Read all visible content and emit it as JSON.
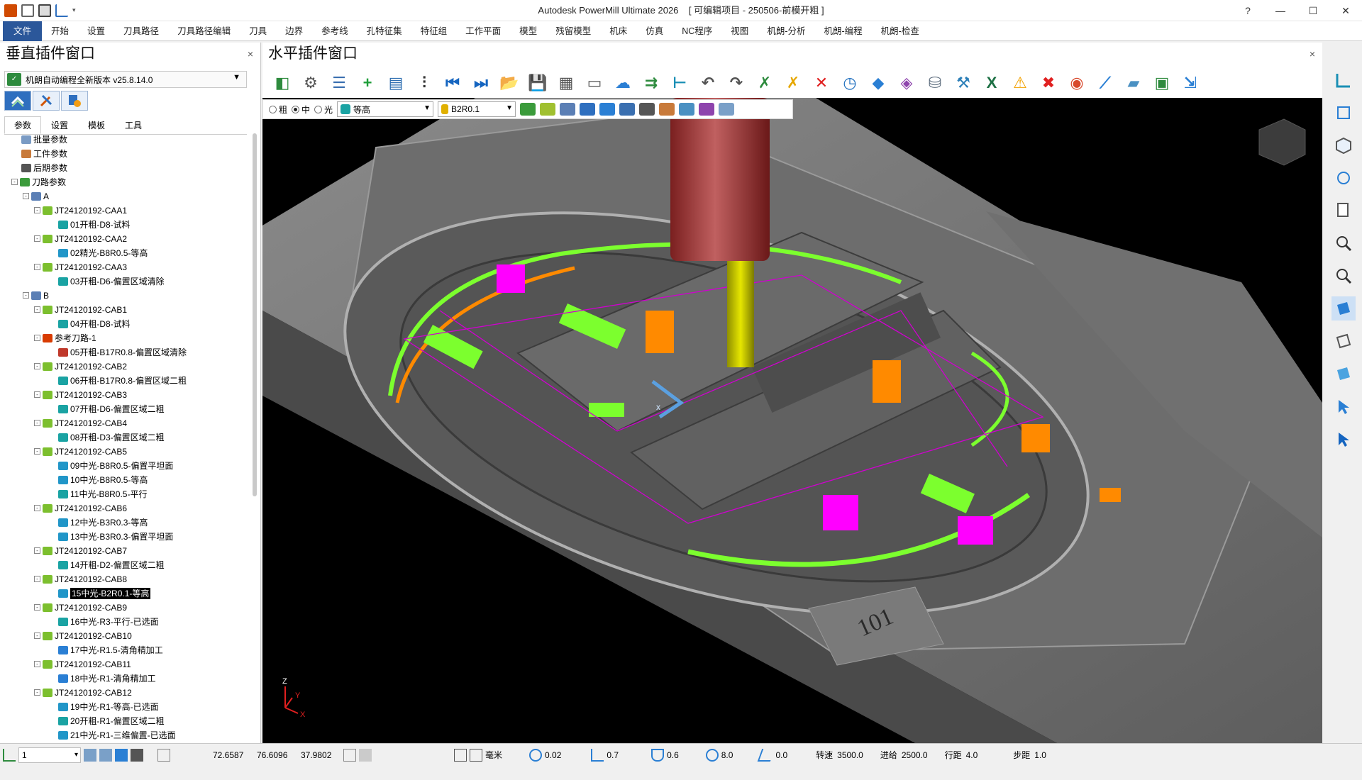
{
  "app": {
    "title": "Autodesk PowerMill Ultimate 2026",
    "project": "[ 可编辑项目 - 250506-前模开粗 ]"
  },
  "window_controls": {
    "help": "?",
    "minimize": "—",
    "maximize": "☐",
    "close": "✕"
  },
  "menu": [
    "文件",
    "开始",
    "设置",
    "刀具路径",
    "刀具路径编辑",
    "刀具",
    "边界",
    "参考线",
    "孔特征集",
    "特征组",
    "工作平面",
    "模型",
    "残留模型",
    "机床",
    "仿真",
    "NC程序",
    "视图",
    "机朗-分析",
    "机朗-编程",
    "机朗-检查"
  ],
  "left_panel": {
    "title": "垂直插件窗口",
    "close": "×",
    "plugin_name": "机朗自动编程全新版本 v25.8.14.0",
    "plugin_logo": "excel-like-logo",
    "subtabs": [
      "参数",
      "设置",
      "模板",
      "工具"
    ],
    "tree": [
      {
        "level": 1,
        "label": "批量参数",
        "icon": "params-icon",
        "color": "#7a9bc4",
        "exp": ""
      },
      {
        "level": 1,
        "label": "工件参数",
        "icon": "stock-icon",
        "color": "#c87a3a",
        "exp": ""
      },
      {
        "level": 1,
        "label": "后期参数",
        "icon": "post-icon",
        "color": "#555555",
        "exp": ""
      },
      {
        "level": 1,
        "label": "刀路参数",
        "icon": "toolpath-params-icon",
        "color": "#3b9b3b",
        "exp": "-"
      },
      {
        "level": 2,
        "label": "A",
        "icon": "folder-icon",
        "color": "#5b7fb5",
        "exp": "-"
      },
      {
        "level": 3,
        "label": "JT24120192-CAA1",
        "icon": "group-icon",
        "color": "#7cbf2e",
        "exp": "-"
      },
      {
        "level": 4,
        "label": "01开粗-D8-试料",
        "icon": "toolpath-icon",
        "color": "#1aa3a3",
        "exp": ""
      },
      {
        "level": 3,
        "label": "JT24120192-CAA2",
        "icon": "group-icon",
        "color": "#7cbf2e",
        "exp": "-"
      },
      {
        "level": 4,
        "label": "02精光-B8R0.5-等高",
        "icon": "toolpath-icon",
        "color": "#2196c8",
        "exp": ""
      },
      {
        "level": 3,
        "label": "JT24120192-CAA3",
        "icon": "group-icon",
        "color": "#7cbf2e",
        "exp": "-"
      },
      {
        "level": 4,
        "label": "03开粗-D6-偏置区域清除",
        "icon": "toolpath-icon",
        "color": "#1aa3a3",
        "exp": ""
      },
      {
        "level": 2,
        "label": "B",
        "icon": "folder-icon",
        "color": "#5b7fb5",
        "exp": "-"
      },
      {
        "level": 3,
        "label": "JT24120192-CAB1",
        "icon": "group-icon",
        "color": "#7cbf2e",
        "exp": "-"
      },
      {
        "level": 4,
        "label": "04开粗-D8-试料",
        "icon": "toolpath-icon",
        "color": "#1aa3a3",
        "exp": ""
      },
      {
        "level": 3,
        "label": "参考刀路-1",
        "icon": "ref-icon",
        "color": "#d83b01",
        "exp": "-"
      },
      {
        "level": 4,
        "label": "05开粗-B17R0.8-偏置区域清除",
        "icon": "toolpath-icon",
        "color": "#c0392b",
        "exp": ""
      },
      {
        "level": 3,
        "label": "JT24120192-CAB2",
        "icon": "group-icon",
        "color": "#7cbf2e",
        "exp": "-"
      },
      {
        "level": 4,
        "label": "06开粗-B17R0.8-偏置区域二粗",
        "icon": "toolpath-icon",
        "color": "#1aa3a3",
        "exp": ""
      },
      {
        "level": 3,
        "label": "JT24120192-CAB3",
        "icon": "group-icon",
        "color": "#7cbf2e",
        "exp": "-"
      },
      {
        "level": 4,
        "label": "07开粗-D6-偏置区域二粗",
        "icon": "toolpath-icon",
        "color": "#1aa3a3",
        "exp": ""
      },
      {
        "level": 3,
        "label": "JT24120192-CAB4",
        "icon": "group-icon",
        "color": "#7cbf2e",
        "exp": "-"
      },
      {
        "level": 4,
        "label": "08开粗-D3-偏置区域二粗",
        "icon": "toolpath-icon",
        "color": "#1aa3a3",
        "exp": ""
      },
      {
        "level": 3,
        "label": "JT24120192-CAB5",
        "icon": "group-icon",
        "color": "#7cbf2e",
        "exp": "-"
      },
      {
        "level": 4,
        "label": "09中光-B8R0.5-偏置平坦面",
        "icon": "toolpath-icon",
        "color": "#2196c8",
        "exp": ""
      },
      {
        "level": 4,
        "label": "10中光-B8R0.5-等高",
        "icon": "toolpath-icon",
        "color": "#2196c8",
        "exp": ""
      },
      {
        "level": 4,
        "label": "11中光-B8R0.5-平行",
        "icon": "toolpath-icon",
        "color": "#1aa3a3",
        "exp": ""
      },
      {
        "level": 3,
        "label": "JT24120192-CAB6",
        "icon": "group-icon",
        "color": "#7cbf2e",
        "exp": "-"
      },
      {
        "level": 4,
        "label": "12中光-B3R0.3-等高",
        "icon": "toolpath-icon",
        "color": "#2196c8",
        "exp": ""
      },
      {
        "level": 4,
        "label": "13中光-B3R0.3-偏置平坦面",
        "icon": "toolpath-icon",
        "color": "#2196c8",
        "exp": ""
      },
      {
        "level": 3,
        "label": "JT24120192-CAB7",
        "icon": "group-icon",
        "color": "#7cbf2e",
        "exp": "-"
      },
      {
        "level": 4,
        "label": "14开粗-D2-偏置区域二粗",
        "icon": "toolpath-icon",
        "color": "#1aa3a3",
        "exp": ""
      },
      {
        "level": 3,
        "label": "JT24120192-CAB8",
        "icon": "group-icon",
        "color": "#7cbf2e",
        "exp": "-"
      },
      {
        "level": 4,
        "label": "15中光-B2R0.1-等高",
        "icon": "toolpath-icon",
        "color": "#2196c8",
        "exp": "",
        "selected": true
      },
      {
        "level": 3,
        "label": "JT24120192-CAB9",
        "icon": "group-icon",
        "color": "#7cbf2e",
        "exp": "-"
      },
      {
        "level": 4,
        "label": "16中光-R3-平行-已选面",
        "icon": "toolpath-icon",
        "color": "#1aa3a3",
        "exp": ""
      },
      {
        "level": 3,
        "label": "JT24120192-CAB10",
        "icon": "group-icon",
        "color": "#7cbf2e",
        "exp": "-"
      },
      {
        "level": 4,
        "label": "17中光-R1.5-清角精加工",
        "icon": "toolpath-icon",
        "color": "#2a7fd4",
        "exp": ""
      },
      {
        "level": 3,
        "label": "JT24120192-CAB11",
        "icon": "group-icon",
        "color": "#7cbf2e",
        "exp": "-"
      },
      {
        "level": 4,
        "label": "18中光-R1-清角精加工",
        "icon": "toolpath-icon",
        "color": "#2a7fd4",
        "exp": ""
      },
      {
        "level": 3,
        "label": "JT24120192-CAB12",
        "icon": "group-icon",
        "color": "#7cbf2e",
        "exp": "-"
      },
      {
        "level": 4,
        "label": "19中光-R1-等高-已选面",
        "icon": "toolpath-icon",
        "color": "#2196c8",
        "exp": ""
      },
      {
        "level": 4,
        "label": "20开粗-R1-偏置区域二粗",
        "icon": "toolpath-icon",
        "color": "#1aa3a3",
        "exp": ""
      },
      {
        "level": 4,
        "label": "21中光-R1-三维偏置-已选面",
        "icon": "toolpath-icon",
        "color": "#2196c8",
        "exp": ""
      }
    ]
  },
  "main_panel": {
    "title": "水平插件窗口",
    "close": "×",
    "toolbar_icons": [
      {
        "name": "layout-icon",
        "color": "#2e8b3e",
        "glyph": "◧"
      },
      {
        "name": "gear-icon",
        "color": "#555555",
        "glyph": "⚙"
      },
      {
        "name": "list-settings-icon",
        "color": "#3a6fb0",
        "glyph": "☰"
      },
      {
        "name": "add-icon",
        "color": "#1f9e3a",
        "glyph": "+"
      },
      {
        "name": "playlist-icon",
        "color": "#2b6cb0",
        "glyph": "▤"
      },
      {
        "name": "sliders-icon",
        "color": "#333333",
        "glyph": "⫶"
      },
      {
        "name": "skip-first-icon",
        "color": "#1565c0",
        "glyph": "⏮"
      },
      {
        "name": "skip-last-icon",
        "color": "#1565c0",
        "glyph": "⏭"
      },
      {
        "name": "open-folder-icon",
        "color": "#2b6cb0",
        "glyph": "📂"
      },
      {
        "name": "save-icon",
        "color": "#444444",
        "glyph": "💾"
      },
      {
        "name": "calculator-icon",
        "color": "#555555",
        "glyph": "▦"
      },
      {
        "name": "window-icon",
        "color": "#555555",
        "glyph": "▭"
      },
      {
        "name": "cloud-icon",
        "color": "#2b7fd4",
        "glyph": "☁"
      },
      {
        "name": "import-icon",
        "color": "#2e8b3e",
        "glyph": "⇉"
      },
      {
        "name": "tree-icon",
        "color": "#1a8fb5",
        "glyph": "⊢"
      },
      {
        "name": "undo-icon",
        "color": "#555555",
        "glyph": "↶"
      },
      {
        "name": "redo-icon",
        "color": "#555555",
        "glyph": "↷"
      },
      {
        "name": "check-cross-icon",
        "color": "#2e8b3e",
        "glyph": "✗"
      },
      {
        "name": "warning-cross-icon",
        "color": "#e6a700",
        "glyph": "✗"
      },
      {
        "name": "delete-icon",
        "color": "#e02020",
        "glyph": "✕"
      },
      {
        "name": "clock-icon",
        "color": "#1f6fbf",
        "glyph": "◷"
      },
      {
        "name": "block-icon",
        "color": "#2a7fd4",
        "glyph": "◆"
      },
      {
        "name": "model-color-icon",
        "color": "#8e44ad",
        "glyph": "◈"
      },
      {
        "name": "database-icon",
        "color": "#5d6d7e",
        "glyph": "⛁"
      },
      {
        "name": "tool-holder-icon",
        "color": "#2c7fb8",
        "glyph": "⚒"
      },
      {
        "name": "excel-icon",
        "color": "#1d7044",
        "glyph": "X"
      },
      {
        "name": "warning-icon",
        "color": "#f2a100",
        "glyph": "⚠"
      },
      {
        "name": "stop-icon",
        "color": "#e02020",
        "glyph": "✖"
      },
      {
        "name": "palette-icon",
        "color": "#d8492c",
        "glyph": "◉"
      },
      {
        "name": "pattern-icon",
        "color": "#2a7fd4",
        "glyph": "⟋"
      },
      {
        "name": "plane-icon",
        "color": "#4a90c2",
        "glyph": "▰"
      },
      {
        "name": "cert-icon",
        "color": "#2e8b3e",
        "glyph": "▣"
      },
      {
        "name": "export-icon",
        "color": "#2a7fd4",
        "glyph": "⇲"
      }
    ],
    "quality": {
      "options": [
        "粗",
        "中",
        "光"
      ],
      "selected": "中"
    },
    "strategy_combo": "等高",
    "tool_combo": "B2R0.1"
  },
  "status_bar": {
    "workplane": "1",
    "coords": [
      "72.6587",
      "76.6096",
      "37.9802"
    ],
    "units": "毫米",
    "tolerance": "0.02",
    "thickness": "0.7",
    "axial_thickness": "0.6",
    "diameter": "8.0",
    "angle": "0.0",
    "spindle_label": "转速",
    "spindle": "3500.0",
    "feed_label": "进给",
    "feed": "2500.0",
    "stepdown_label": "行距",
    "stepdown": "4.0",
    "stepover_label": "步距",
    "stepover": "1.0"
  },
  "viewport": {
    "part_label": "101",
    "axis_z": "Z",
    "axis_y": "Y",
    "axis_x": "X"
  }
}
